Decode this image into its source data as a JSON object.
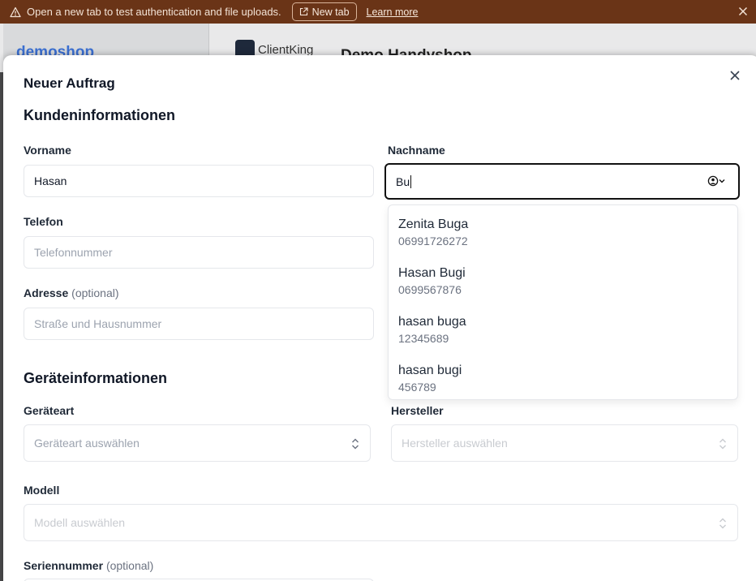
{
  "banner": {
    "message": "Open a new tab to test authentication and file uploads.",
    "new_tab_label": "New tab",
    "learn_more_label": "Learn more",
    "background_color": "#6a3417"
  },
  "background_page": {
    "brand": "demoshop",
    "logo_text": "ClientKing",
    "title": "Demo Handyshop"
  },
  "modal": {
    "title": "Neuer Auftrag",
    "customer_section": "Kundeninformationen",
    "device_section": "Geräteinformationen",
    "first_name": {
      "label": "Vorname",
      "value": "Hasan"
    },
    "last_name": {
      "label": "Nachname",
      "value": "Bu"
    },
    "phone": {
      "label": "Telefon",
      "placeholder": "Telefonnummer"
    },
    "address": {
      "label": "Adresse",
      "optional": "(optional)",
      "placeholder": "Straße und Hausnummer"
    },
    "device_type": {
      "label": "Geräteart",
      "placeholder": "Geräteart auswählen"
    },
    "manufacturer": {
      "label": "Hersteller",
      "placeholder": "Hersteller auswählen"
    },
    "model": {
      "label": "Modell",
      "placeholder": "Modell auswählen"
    },
    "serial": {
      "label": "Seriennummer",
      "optional": "(optional)"
    }
  },
  "suggestions": [
    {
      "name": "Zenita Buga",
      "phone": "06991726272"
    },
    {
      "name": "Hasan Bugi",
      "phone": "0699567876"
    },
    {
      "name": "hasan buga",
      "phone": "12345689"
    },
    {
      "name": "hasan bugi",
      "phone": "456789"
    }
  ],
  "icons": {
    "banner_warning": "warning-triangle-icon",
    "banner_new_tab": "external-link-icon",
    "banner_close": "close-icon",
    "modal_close": "close-icon",
    "lookup": "user-circle-chevron-icon",
    "select": "chevron-up-down-icon"
  }
}
